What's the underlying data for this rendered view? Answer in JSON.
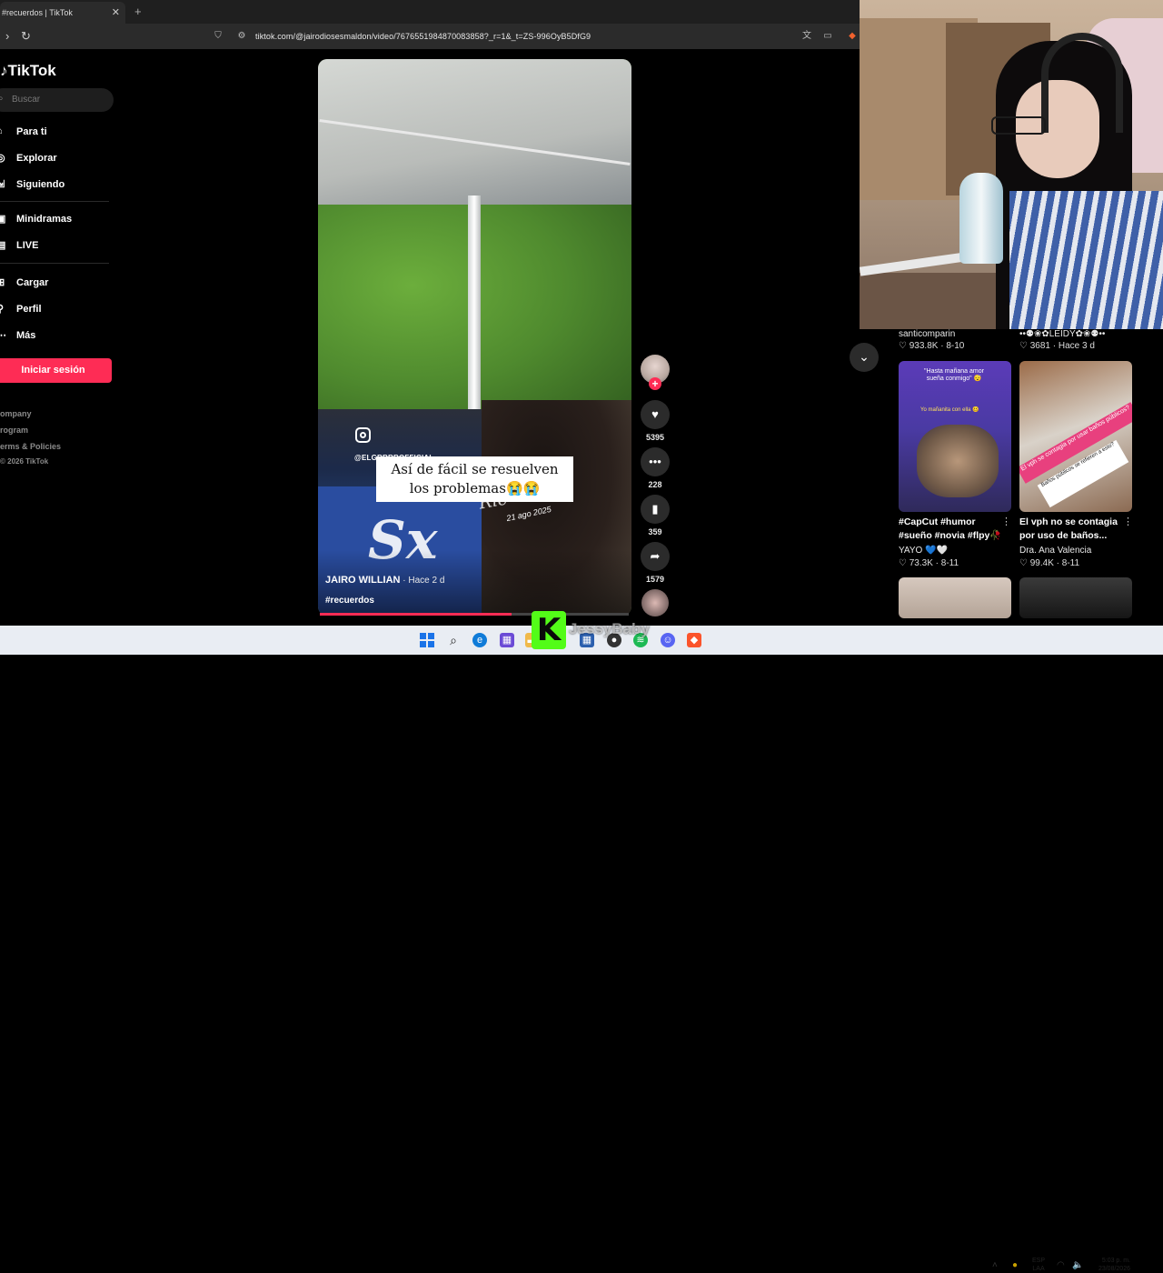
{
  "browser": {
    "tab_title": "#recuerdos | TikTok",
    "tab_close": "✕",
    "new_tab": "+",
    "url": "tiktok.com/@jairodiosesmaldon/video/7676551984870083858?_r=1&_t=ZS-996OyB5DfG9"
  },
  "sidebar": {
    "logo": "TikTok",
    "search_placeholder": "Buscar",
    "items": [
      {
        "label": "Para ti",
        "icon": "home-icon"
      },
      {
        "label": "Explorar",
        "icon": "compass-icon"
      },
      {
        "label": "Siguiendo",
        "icon": "following-icon"
      },
      {
        "label": "Minidramas",
        "icon": "drama-icon"
      },
      {
        "label": "LIVE",
        "icon": "live-icon"
      },
      {
        "label": "Cargar",
        "icon": "upload-icon"
      },
      {
        "label": "Perfil",
        "icon": "profile-icon"
      },
      {
        "label": "Más",
        "icon": "more-icon"
      }
    ],
    "login_button": "Iniciar sesión",
    "footer": [
      "ompany",
      "rogram",
      "erms & Policies",
      "© 2026 TikTok"
    ]
  },
  "video": {
    "ig_handle": "@ELGRRRROFFICIAL",
    "caption_line1": "Así de fácil se resuelven",
    "caption_line2": "los problemas😭😭",
    "watermark_date": "21 ago 2025",
    "author": "JAIRO WILLIAN",
    "posted": " · Hace 2 d",
    "hashtag": "#recuerdos",
    "progress": 0.62
  },
  "actions": {
    "likes": "5395",
    "comments": "228",
    "saves": "359",
    "shares": "1579"
  },
  "related": {
    "top_left_name": "santicomparin",
    "top_left_stat": "♡ 933.8K · 8-10",
    "top_right_name": "••⚉❀✿LEIDY✿❀⚉••",
    "top_right_stat": "♡ 3681 · Hace 3 d",
    "card1": {
      "thumb_text1": "\"Hasta mañana amor sueña conmigo\" 😴",
      "thumb_text2": "Yo mañanita con ella 🥴",
      "title": "#CapCut #humor #sueño #novia #flpy🥀",
      "author": "YAYO 💙🤍",
      "stat": "♡ 73.3K · 8-11"
    },
    "card2": {
      "thumb_text1": "El vph se contagia por usar baños públicos?",
      "thumb_text2": "Baños públicos se refieren a esto?",
      "title": "El vph no se contagia por uso de baños...",
      "author": "Dra. Ana Valencia",
      "stat": "♡ 99.4K · 8-11"
    }
  },
  "overlay": {
    "kick_letter": "K",
    "streamer_name": "JessyBaby"
  },
  "taskbar": {
    "lang_top": "ESP",
    "lang_bottom": "LAA",
    "time": "5:03 p. m.",
    "date": "23/08/2026"
  },
  "colors": {
    "accent": "#fe2c55",
    "kick_green": "#53fc18"
  }
}
